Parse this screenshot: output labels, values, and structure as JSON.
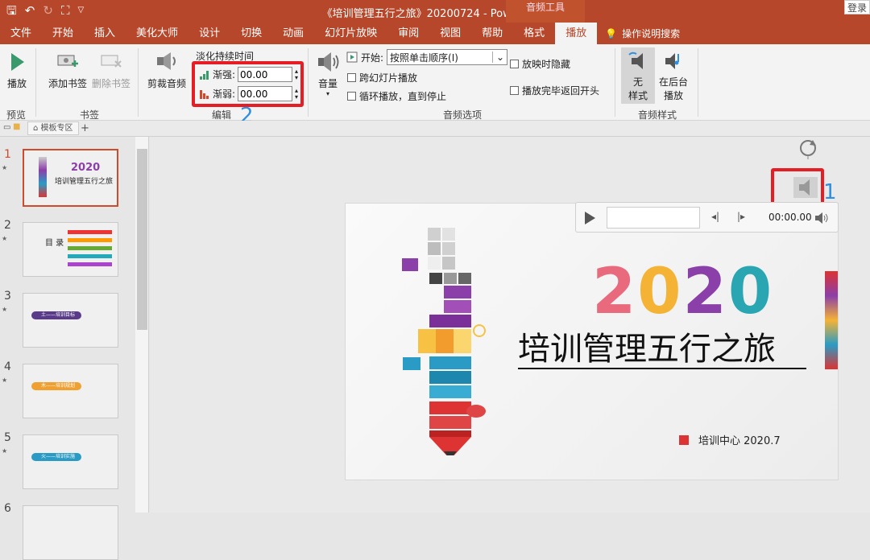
{
  "titlebar": {
    "doc_title": "《培训管理五行之旅》20200724  -  PowerPoint",
    "tools_label": "音频工具",
    "login": "登录"
  },
  "tabs": [
    "文件",
    "开始",
    "插入",
    "美化大师",
    "设计",
    "切换",
    "动画",
    "幻灯片放映",
    "审阅",
    "视图",
    "帮助",
    "格式",
    "播放"
  ],
  "active_tab": "播放",
  "help_label": "操作说明搜索",
  "ribbon": {
    "preview": {
      "play": "播放",
      "group": "预览"
    },
    "bookmarks": {
      "add": "添加书签",
      "remove": "删除书签",
      "group": "书签"
    },
    "editing": {
      "trim": "剪裁音频",
      "fade_title": "淡化持续时间",
      "fade_in_label": "渐强:",
      "fade_in_value": "00.00",
      "fade_out_label": "渐弱:",
      "fade_out_value": "00.00",
      "group": "编辑"
    },
    "audio_options": {
      "volume": "音量",
      "start_label": "开始:",
      "start_value": "按照单击顺序(I)",
      "cross_slides": "跨幻灯片播放",
      "loop": "循环播放，直到停止",
      "hide": "放映时隐藏",
      "rewind": "播放完毕返回开头",
      "group": "音频选项"
    },
    "audio_styles": {
      "no_style_1": "无",
      "no_style_2": "样式",
      "bg_1": "在后台",
      "bg_2": "播放",
      "group": "音频样式"
    }
  },
  "subbar": {
    "tab": "模板专区"
  },
  "thumbnails": [
    {
      "num": "1",
      "title": "2020",
      "subtitle": "培训管理五行之旅"
    },
    {
      "num": "2",
      "title": "目 录"
    },
    {
      "num": "3",
      "title": "土——培训目标"
    },
    {
      "num": "4",
      "title": "木——培训规划"
    },
    {
      "num": "5",
      "title": "火——培训实施"
    },
    {
      "num": "6"
    }
  ],
  "slide": {
    "year": "2020",
    "title": "培训管理五行之旅",
    "footer": "培训中心  2020.7"
  },
  "player": {
    "time": "00:00.00"
  },
  "annotations": {
    "one": "1",
    "two": "2"
  },
  "colors": {
    "accent": "#b7472a",
    "highlight": "#e41e24",
    "annotation": "#2f8fe0"
  }
}
